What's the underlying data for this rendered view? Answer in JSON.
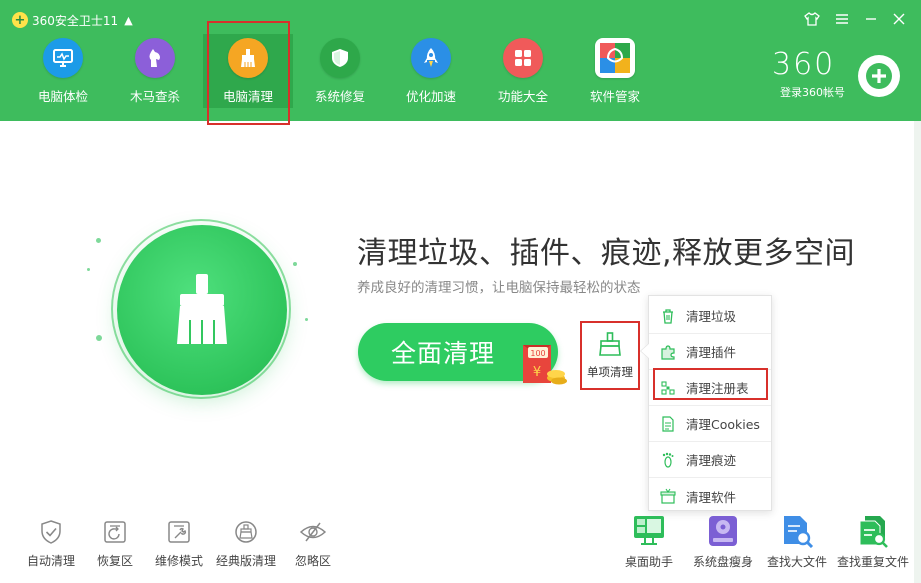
{
  "app": {
    "title": "360安全卫士11",
    "logo_icon": "360-logo-icon"
  },
  "window_controls": [
    "shirt-icon",
    "menu-icon",
    "minimize-icon",
    "close-icon"
  ],
  "nav": [
    {
      "label": "电脑体检",
      "icon": "monitor-icon",
      "color": "#1c9be8"
    },
    {
      "label": "木马查杀",
      "icon": "horse-icon",
      "color": "#8c5fd9"
    },
    {
      "label": "电脑清理",
      "icon": "broom-icon",
      "color": "#f5a623"
    },
    {
      "label": "系统修复",
      "icon": "shield-icon",
      "color": "#2ea84a"
    },
    {
      "label": "优化加速",
      "icon": "rocket-icon",
      "color": "#2b8fe6"
    },
    {
      "label": "功能大全",
      "icon": "grid-icon",
      "color": "#f05a5a"
    },
    {
      "label": "软件管家",
      "icon": "software-manager-icon",
      "color": "#f2b21c"
    }
  ],
  "active_nav": "电脑清理",
  "brand": {
    "logo_text": "360",
    "login_label": "登录360帐号"
  },
  "main": {
    "headline": "清理垃圾、插件、痕迹,释放更多空间",
    "subline": "养成良好的清理习惯，让电脑保持最轻松的状态",
    "full_clean_label": "全面清理",
    "redpacket_text": "100",
    "single_clean_label": "单项清理"
  },
  "dropdown": [
    {
      "label": "清理垃圾",
      "icon": "trash-icon"
    },
    {
      "label": "清理插件",
      "icon": "puzzle-icon"
    },
    {
      "label": "清理注册表",
      "icon": "registry-icon"
    },
    {
      "label": "清理Cookies",
      "icon": "document-icon"
    },
    {
      "label": "清理痕迹",
      "icon": "footprint-icon"
    },
    {
      "label": "清理软件",
      "icon": "box-icon"
    }
  ],
  "bottom_left": [
    {
      "label": "自动清理",
      "icon": "shield-check-icon"
    },
    {
      "label": "恢复区",
      "icon": "restore-icon"
    },
    {
      "label": "维修模式",
      "icon": "wrench-icon"
    },
    {
      "label": "经典版清理",
      "icon": "classic-clean-icon"
    },
    {
      "label": "忽略区",
      "icon": "eye-slash-icon"
    }
  ],
  "bottom_right": [
    {
      "label": "桌面助手",
      "icon": "desktop-icon"
    },
    {
      "label": "系统盘瘦身",
      "icon": "disk-icon"
    },
    {
      "label": "查找大文件",
      "icon": "search-file-icon"
    },
    {
      "label": "查找重复文件",
      "icon": "duplicate-file-icon"
    }
  ],
  "colors": {
    "header": "#3ebc5d",
    "accent_green": "#2ecc61",
    "highlight_red": "#d8302b"
  }
}
